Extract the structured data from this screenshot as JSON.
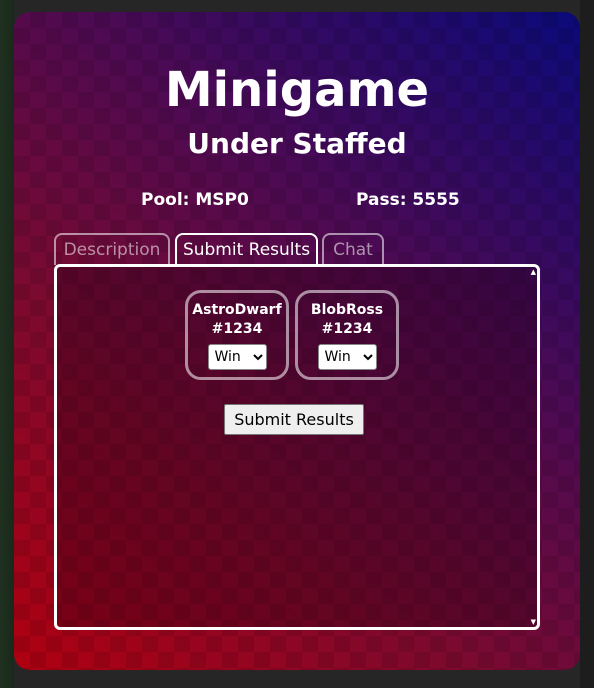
{
  "header": {
    "title": "Minigame",
    "subtitle": "Under Staffed"
  },
  "info": {
    "pool": "Pool: MSP0",
    "pass": "Pass: 5555"
  },
  "tabs": [
    {
      "label": "Description",
      "active": false
    },
    {
      "label": "Submit Results",
      "active": true
    },
    {
      "label": "Chat",
      "active": false
    }
  ],
  "players": [
    {
      "name": "AstroDwarf",
      "tag": "#1234",
      "result": "Win"
    },
    {
      "name": "BlobRoss",
      "tag": "#1234",
      "result": "Win"
    }
  ],
  "result_options": [
    "Win"
  ],
  "submit_label": "Submit Results",
  "scroll": {
    "up": "▲",
    "down": "▼"
  },
  "colors": {
    "gradient_bottom_left": "#b00010",
    "gradient_top_right": "#0a0a7a",
    "text": "#ffffff"
  }
}
